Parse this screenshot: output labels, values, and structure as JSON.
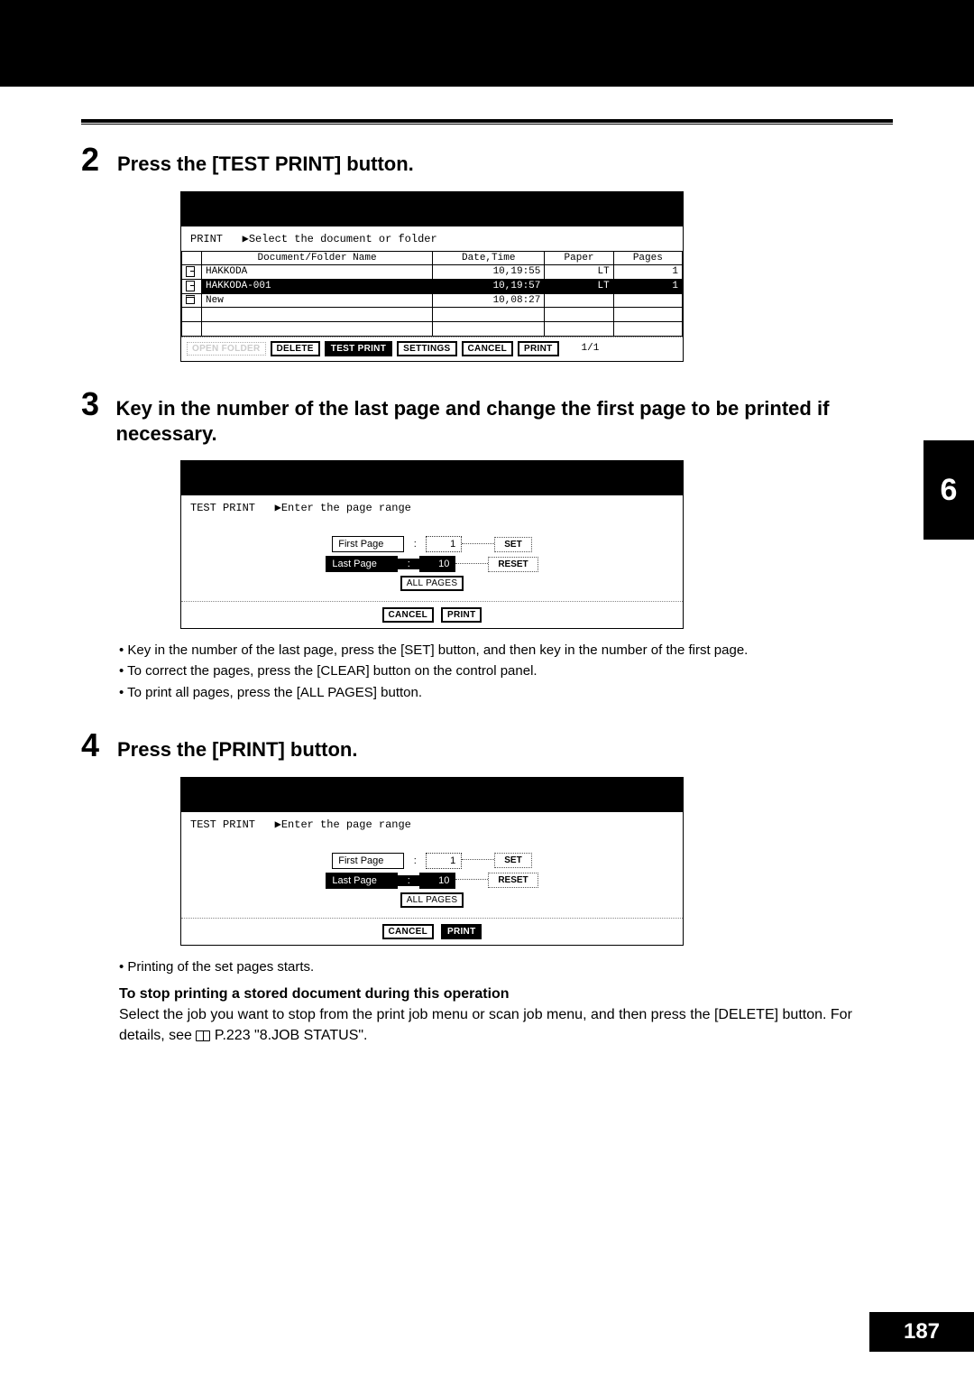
{
  "step2": {
    "title": "Press the [TEST PRINT] button.",
    "num": "2"
  },
  "screen1": {
    "prompt_left": "PRINT",
    "prompt_right": "▶Select the document or folder",
    "cols": {
      "name": "Document/Folder Name",
      "date": "Date,Time",
      "paper": "Paper",
      "pages": "Pages"
    },
    "rows": [
      {
        "name": "HAKKODA",
        "date": "10,19:55",
        "paper": "LT",
        "pages": "1",
        "type": "doc",
        "sel": false
      },
      {
        "name": "HAKKODA-001",
        "date": "10,19:57",
        "paper": "LT",
        "pages": "1",
        "type": "doc",
        "sel": true
      },
      {
        "name": "New",
        "date": "10,08:27",
        "paper": "",
        "pages": "",
        "type": "folder",
        "sel": false
      }
    ],
    "buttons": {
      "open_folder": "OPEN FOLDER",
      "delete": "DELETE",
      "test_print": "TEST PRINT",
      "settings": "SETTINGS",
      "cancel": "CANCEL",
      "print": "PRINT"
    },
    "page_ind": "1/1"
  },
  "step3": {
    "num": "3",
    "title": "Key in the number of the last page and change the first page to be printed if necessary."
  },
  "screen2": {
    "prompt_left": "TEST PRINT",
    "prompt_right": "▶Enter the page range",
    "first_label": "First Page",
    "last_label": "Last Page",
    "first_val": "1",
    "last_val": "10",
    "set": "SET",
    "reset": "RESET",
    "all_pages": "ALL PAGES",
    "cancel": "CANCEL",
    "print": "PRINT"
  },
  "notes3": {
    "a": "Key in the number of the last page, press the [SET] button, and then key in the number of the first page.",
    "b": "To correct the pages, press the [CLEAR] button on the control panel.",
    "c": "To print all pages, press the [ALL PAGES] button."
  },
  "step4": {
    "num": "4",
    "title": "Press the [PRINT] button."
  },
  "notes4": {
    "a": "Printing of the set pages starts."
  },
  "stop": {
    "heading": "To stop printing a stored document during this operation",
    "body_a": "Select the job you want to stop from the print job menu or scan job menu, and then press the [DELETE] button. For details, see ",
    "body_b": " P.223 \"8.JOB STATUS\"."
  },
  "side_tab": "6",
  "page_num": "187"
}
